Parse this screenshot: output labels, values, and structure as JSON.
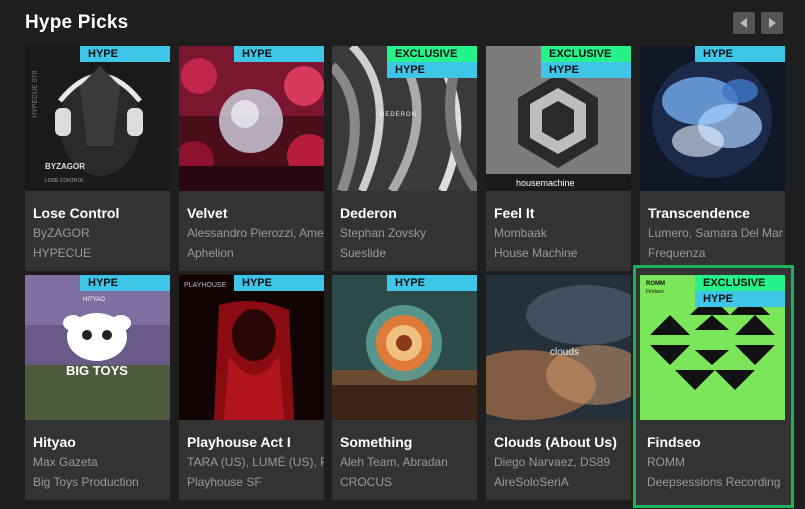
{
  "section": {
    "title": "Hype Picks"
  },
  "colors": {
    "hype_badge": "#3fc5e8",
    "exclusive_badge": "#26f28a",
    "selected_border": "#1db25b",
    "card_bg": "#333333",
    "page_bg": "#1e1e1e"
  },
  "nav": {
    "prev_icon": "chevron-left-icon",
    "next_icon": "chevron-right-icon"
  },
  "cards": [
    {
      "track": "Lose Control",
      "artist": "ByZAGOR",
      "label": "HYPECUE",
      "badges": [
        "HYPE"
      ],
      "art_text": "BYZAGOR",
      "art_sub": "LOSE CONTROL",
      "art_side": "HYPECUE 078"
    },
    {
      "track": "Velvet",
      "artist": "Alessandro Pierozzi, Ame",
      "label": "Aphelion",
      "badges": [
        "HYPE"
      ]
    },
    {
      "track": "Dederon",
      "artist": "Stephan Zovsky",
      "label": "Sueslide",
      "badges": [
        "EXCLUSIVE",
        "HYPE"
      ],
      "art_text": "DEDERON"
    },
    {
      "track": "Feel It",
      "artist": "Mombaak",
      "label": "House Machine",
      "badges": [
        "EXCLUSIVE",
        "HYPE"
      ],
      "art_text": "housemachine"
    },
    {
      "track": "Transcendence",
      "artist": "Lumero, Samara Del Mar",
      "label": "Frequenza",
      "badges": [
        "HYPE"
      ]
    },
    {
      "track": "Hityao",
      "artist": "Max Gazeta",
      "label": "Big Toys Production",
      "badges": [
        "HYPE"
      ],
      "art_text": "BIG TOYS",
      "art_sub": "HITYAO"
    },
    {
      "track": "Playhouse Act I",
      "artist": "TARA (US), LUMÉ (US), P",
      "label": "Playhouse SF",
      "badges": [
        "HYPE"
      ],
      "art_text": "PLAYHOUSE"
    },
    {
      "track": "Something",
      "artist": "Aleh Team, Abradan",
      "label": "CROCUS",
      "badges": [
        "HYPE"
      ]
    },
    {
      "track": "Clouds (About Us)",
      "artist": "Diego Narvaez, DS89",
      "label": "AireSoloSeriA",
      "badges": [],
      "art_text": "clouds"
    },
    {
      "track": "Findseo",
      "artist": "ROMM",
      "label": "Deepsessions Recording",
      "badges": [
        "EXCLUSIVE",
        "HYPE"
      ],
      "art_text": "ROMM",
      "art_sub": "Findseo",
      "selected": true
    }
  ]
}
